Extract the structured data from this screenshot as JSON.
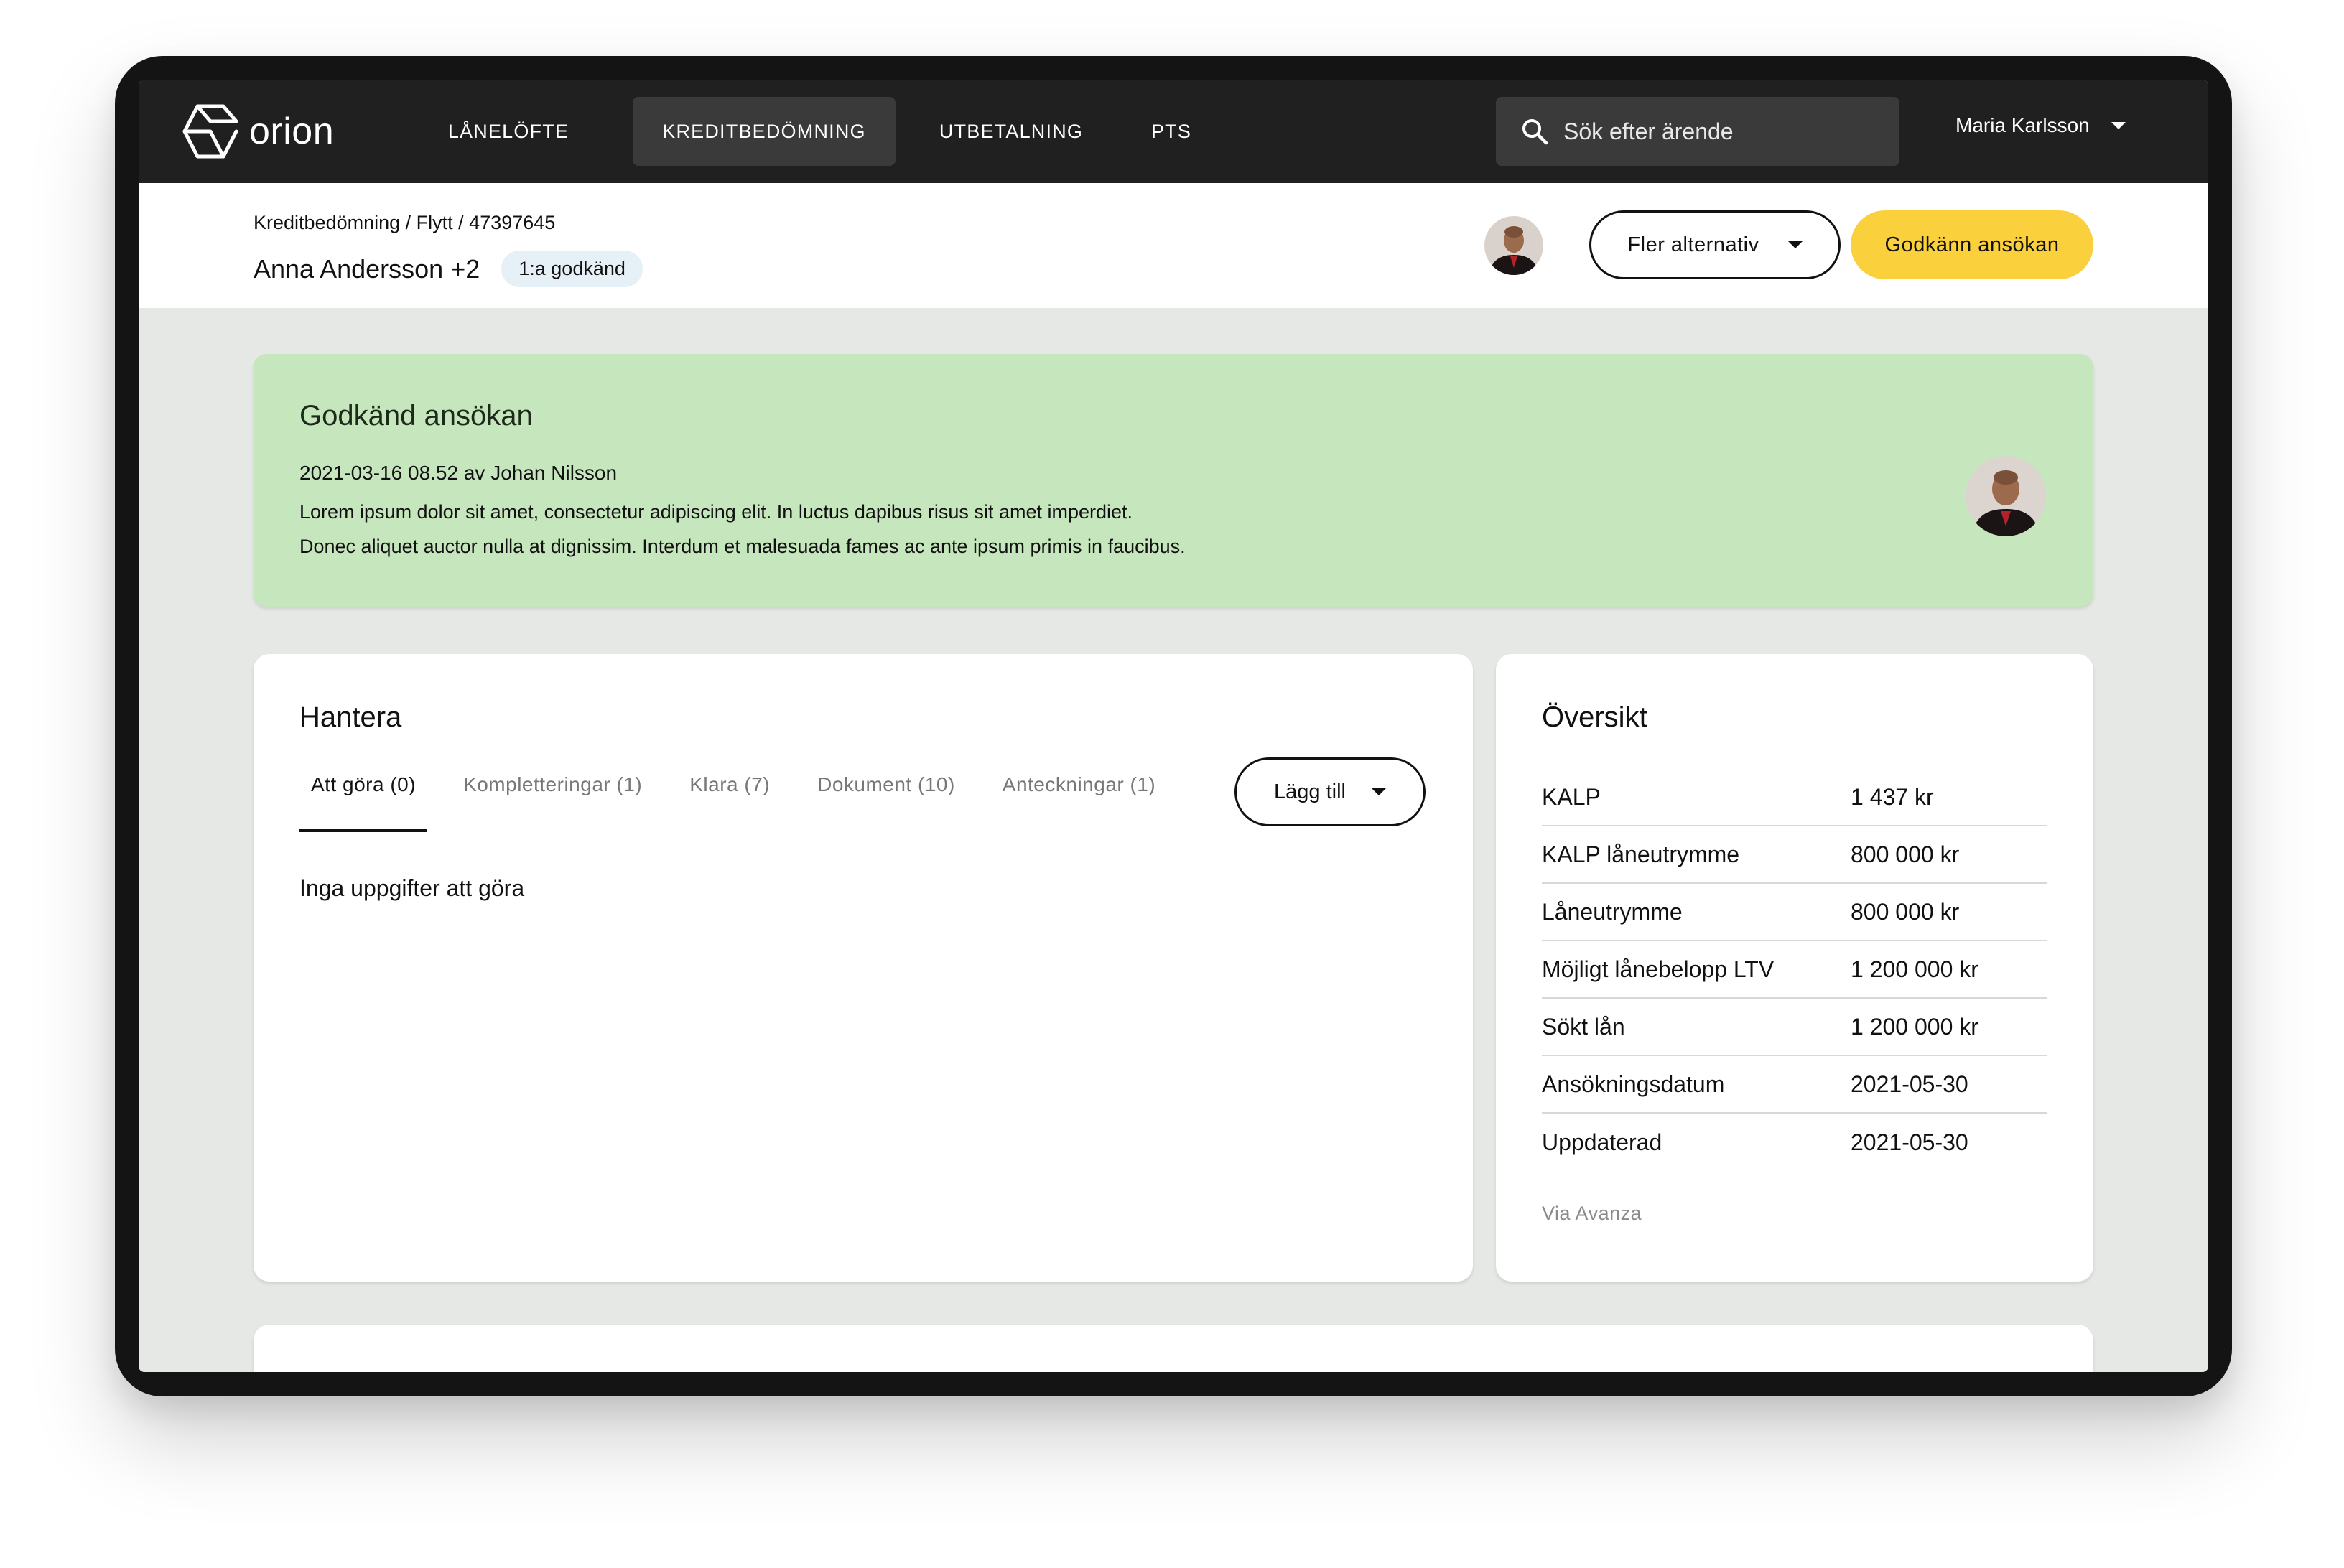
{
  "nav": {
    "logo_text": "orion",
    "items": [
      "LÅNELÖFTE",
      "KREDITBEDÖMNING",
      "UTBETALNING",
      "PTS"
    ],
    "active_item": "KREDITBEDÖMNING",
    "search_placeholder": "Sök efter ärende",
    "user_name": "Maria Karlsson"
  },
  "header": {
    "breadcrumb": [
      "Kreditbedömning",
      "Flytt",
      "47397645"
    ],
    "breadcrumb_separator": " / ",
    "case_name": "Anna Andersson +2",
    "status_badge": "1:a godkänd",
    "more_options_label": "Fler alternativ",
    "approve_label": "Godkänn ansökan"
  },
  "banner": {
    "title": "Godkänd ansökan",
    "meta": "2021-03-16 08.52 av Johan Nilsson",
    "line1": "Lorem ipsum dolor sit amet, consectetur adipiscing elit. In luctus dapibus risus sit amet imperdiet.",
    "line2": "Donec aliquet auctor nulla at dignissim. Interdum et malesuada fames ac ante ipsum primis in faucibus."
  },
  "manage": {
    "title": "Hantera",
    "tabs": [
      "Att göra (0)",
      "Kompletteringar (1)",
      "Klara (7)",
      "Dokument (10)",
      "Anteckningar (1)"
    ],
    "active_tab": "Att göra (0)",
    "add_label": "Lägg till",
    "empty_text": "Inga uppgifter att göra"
  },
  "overview": {
    "title": "Översikt",
    "rows": [
      {
        "label": "KALP",
        "value": "1 437 kr"
      },
      {
        "label": "KALP låneutrymme",
        "value": "800 000 kr"
      },
      {
        "label": "Låneutrymme",
        "value": "800 000 kr"
      },
      {
        "label": "Möjligt lånebelopp LTV",
        "value": "1 200 000 kr"
      },
      {
        "label": "Sökt lån",
        "value": "1 200 000 kr"
      },
      {
        "label": "Ansökningsdatum",
        "value": "2021-05-30"
      },
      {
        "label": "Uppdaterad",
        "value": "2021-05-30"
      }
    ],
    "source": "Via Avanza"
  },
  "colors": {
    "nav_bg": "#202020",
    "accent_yellow": "#fbd03d",
    "banner_green": "#c6e6bd",
    "badge_blue": "#e6f0f7",
    "page_bg": "#e5e8e4"
  },
  "icons": {
    "logo": "orion-logo-icon",
    "search": "search-icon",
    "dropdown": "caret-down-icon"
  }
}
